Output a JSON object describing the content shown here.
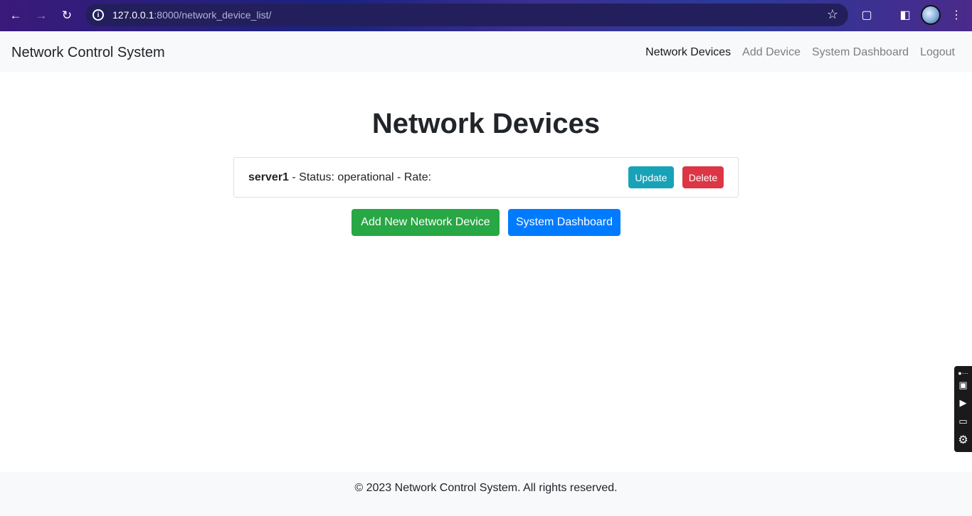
{
  "browser": {
    "url_host": "127.0.0.1",
    "url_rest": ":8000/network_device_list/"
  },
  "navbar": {
    "brand": "Network Control System",
    "links": [
      {
        "label": "Network Devices",
        "active": true
      },
      {
        "label": "Add Device",
        "active": false
      },
      {
        "label": "System Dashboard",
        "active": false
      },
      {
        "label": "Logout",
        "active": false
      }
    ]
  },
  "main": {
    "title": "Network Devices",
    "devices": [
      {
        "name": "server1",
        "details": " - Status: operational - Rate:",
        "update_label": "Update",
        "delete_label": "Delete"
      }
    ],
    "add_button": "Add New Network Device",
    "dashboard_button": "System Dashboard"
  },
  "footer": {
    "text": "© 2023 Network Control System. All rights reserved."
  },
  "colors": {
    "update": "#17a2b8",
    "delete": "#dc3545",
    "add": "#28a745",
    "dashboard": "#007bff"
  }
}
